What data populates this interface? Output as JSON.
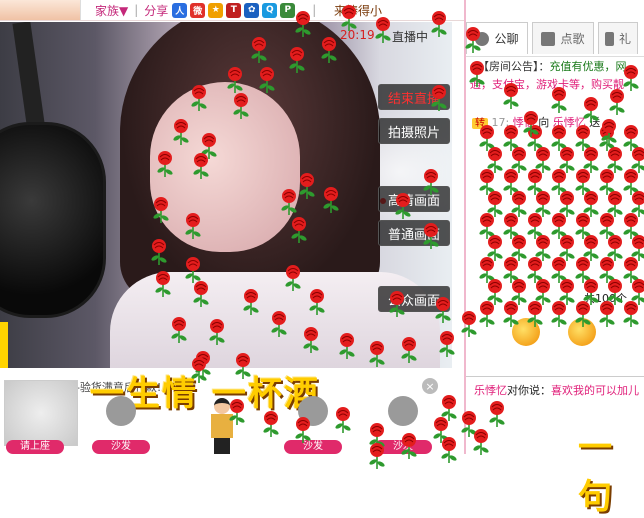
{
  "toolbar": {
    "family_label": "家族▼",
    "share_label": "分享",
    "separator": "|",
    "status_text": "来捧得小",
    "count_text": "20:19",
    "broadcasting": "直播中",
    "icons": [
      "profile-icon",
      "weibo-icon",
      "star-icon",
      "game-icon",
      "paw-icon",
      "qq-icon",
      "tencent-icon"
    ]
  },
  "video": {
    "end_live_label": "结束直播",
    "take_photo_label": "拍摄照片",
    "hd_view_label": "高清画面",
    "normal_view_label": "普通画面",
    "public_view_label": "公众画面"
  },
  "ad": {
    "text": "苹果手机-1折-验货满意后付款!",
    "close_label": "×",
    "song_title": "一生情 一杯酒",
    "song_bottom": "一句"
  },
  "seats": [
    {
      "label": "请上座"
    },
    {
      "label": "沙发"
    },
    {
      "label": "沙发"
    },
    {
      "label": "沙发"
    }
  ],
  "right_panel": {
    "tabs": [
      {
        "label": "公聊",
        "icon": "chat-icon"
      },
      {
        "label": "点歌",
        "icon": "music-icon"
      },
      {
        "label": "礼",
        "icon": "gift-icon"
      }
    ],
    "notice_prefix": "【房间公告】：",
    "notice_text": "充值有优惠，网",
    "notice_text2": "通，支付宝，游戏卡等，购买靓",
    "turn_badge": "转",
    "line_time": "17:",
    "line_user": "悸忆",
    "line_to": "向",
    "line_target": "乐悸忆",
    "line_action": "送",
    "line_total": "共100个",
    "line_speaker": "乐悸忆",
    "line_said": "对你说：",
    "line_message": "喜欢我的可以加儿"
  },
  "colors": {
    "accent_pink": "#e0207a",
    "rose_red": "#e31d1d",
    "leaf_green": "#2e9a2e",
    "song_gold": "#ffcc00"
  }
}
